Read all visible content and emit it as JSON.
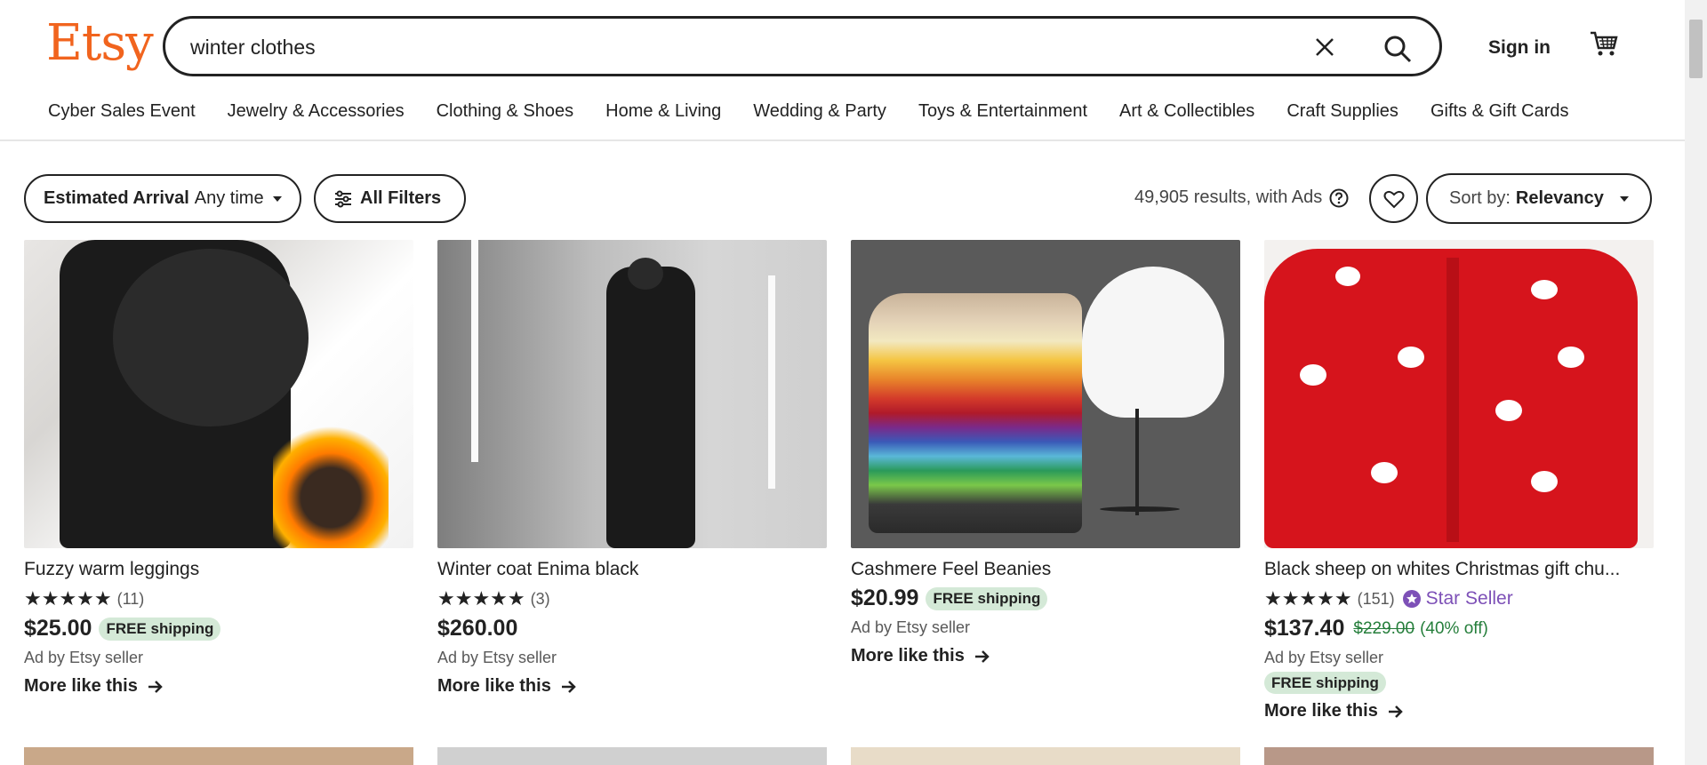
{
  "brand": {
    "logo": "Etsy",
    "color": "#f1641e"
  },
  "search": {
    "value": "winter clothes"
  },
  "header": {
    "signin": "Sign in"
  },
  "nav": [
    "Cyber Sales Event",
    "Jewelry & Accessories",
    "Clothing & Shoes",
    "Home & Living",
    "Wedding & Party",
    "Toys & Entertainment",
    "Art & Collectibles",
    "Craft Supplies",
    "Gifts & Gift Cards"
  ],
  "filters": {
    "arrival_label": "Estimated Arrival",
    "arrival_value": "Any time",
    "all_filters": "All Filters",
    "results": "49,905 results, with Ads",
    "sort_label": "Sort by:",
    "sort_value": "Relevancy"
  },
  "products": [
    {
      "title": "Fuzzy warm leggings",
      "stars": "★★★★★",
      "reviews": "(11)",
      "price": "$25.00",
      "shipping": "FREE shipping",
      "ad": "Ad by Etsy seller",
      "more": "More like this"
    },
    {
      "title": "Winter coat Enima black",
      "stars": "★★★★★",
      "reviews": "(3)",
      "price": "$260.00",
      "ad": "Ad by Etsy seller",
      "more": "More like this"
    },
    {
      "title": "Cashmere Feel Beanies",
      "price": "$20.99",
      "shipping": "FREE shipping",
      "ad": "Ad by Etsy seller",
      "more": "More like this"
    },
    {
      "title": "Black sheep on whites Christmas gift chu...",
      "stars": "★★★★★",
      "reviews": "(151)",
      "star_seller": "Star Seller",
      "price": "$137.40",
      "old_price": "$229.00",
      "discount": "(40% off)",
      "ad": "Ad by Etsy seller",
      "shipping": "FREE shipping",
      "more": "More like this"
    }
  ]
}
